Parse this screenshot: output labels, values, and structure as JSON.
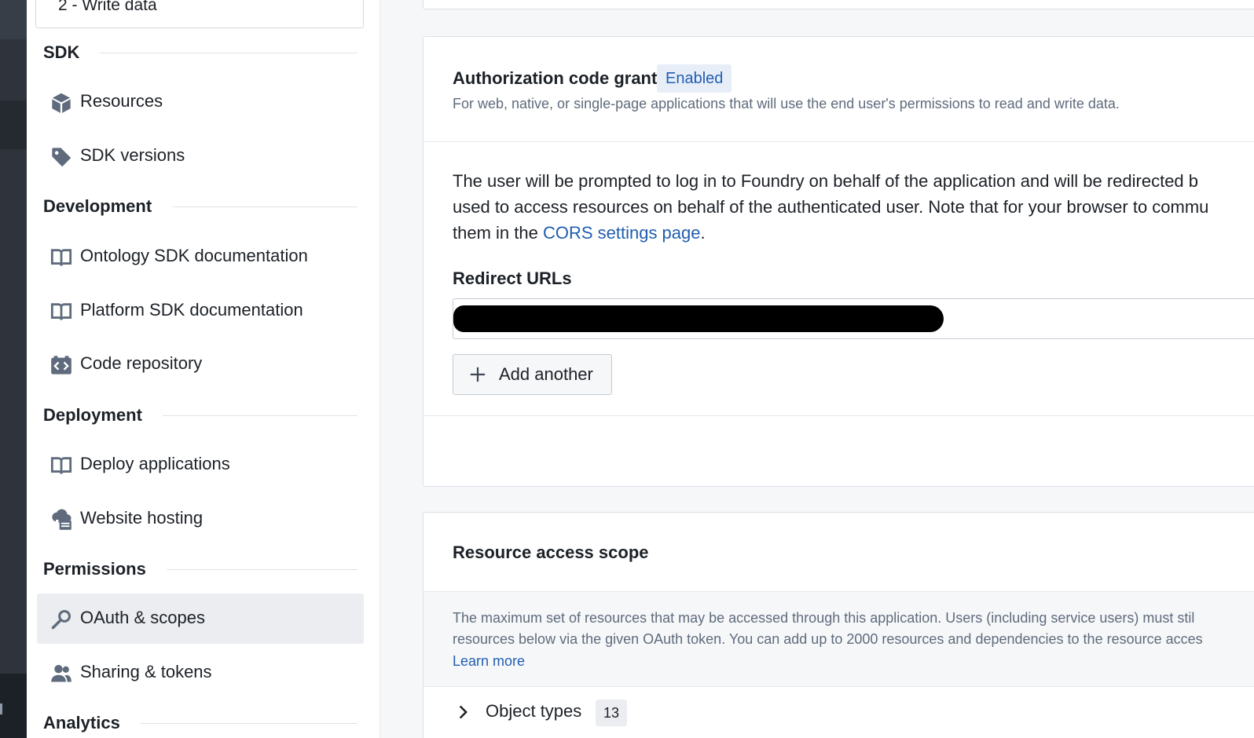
{
  "sidebar": {
    "previous_card_label": "2 - Write data",
    "sections": {
      "sdk": "SDK",
      "development": "Development",
      "deployment": "Deployment",
      "permissions": "Permissions",
      "analytics": "Analytics"
    },
    "items": {
      "resources": "Resources",
      "sdk_versions": "SDK versions",
      "ontology_sdk_docs": "Ontology SDK documentation",
      "platform_sdk_docs": "Platform SDK documentation",
      "code_repository": "Code repository",
      "deploy_applications": "Deploy applications",
      "website_hosting": "Website hosting",
      "oauth_scopes": "OAuth & scopes",
      "sharing_tokens": "Sharing & tokens"
    },
    "active_item": "OAuth & scopes"
  },
  "auth_card": {
    "title": "Authorization code grant",
    "badge": "Enabled",
    "subtitle": "For web, native, or single-page applications that will use the end user's permissions to read and write data.",
    "desc_line1": "The user will be prompted to log in to Foundry on behalf of the application and will be redirected b",
    "desc_line2": "used to access resources on behalf of the authenticated user. Note that for your browser to commu",
    "desc_line3_prefix": "them in the ",
    "desc_link": "CORS settings page",
    "desc_line3_suffix": ".",
    "redirect_label": "Redirect URLs",
    "add_button": "Add another"
  },
  "resource_card": {
    "title": "Resource access scope",
    "desc_line1": "The maximum set of resources that may be accessed through this application. Users (including service users) must stil",
    "desc_line2": "resources below via the given OAuth token. You can add up to 2000 resources and dependencies to the resource acces",
    "learn_more": "Learn more",
    "object_types_label": "Object types",
    "object_types_count": "13"
  },
  "colors": {
    "link": "#215db0",
    "badge_bg": "#e7eef8",
    "rail": "#2f343c",
    "active_bg": "#ebedf0"
  }
}
